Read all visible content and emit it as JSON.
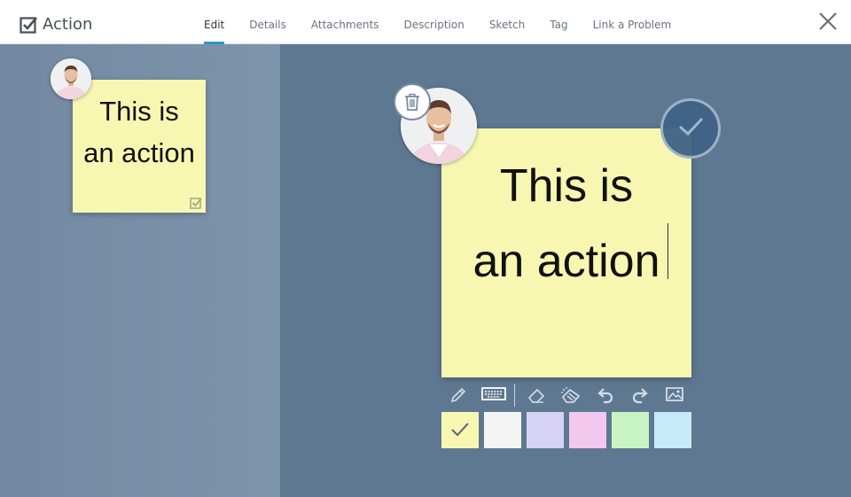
{
  "header": {
    "title": "Action",
    "tabs": [
      {
        "label": "Edit",
        "active": true
      },
      {
        "label": "Details"
      },
      {
        "label": "Attachments"
      },
      {
        "label": "Description"
      },
      {
        "label": "Sketch"
      },
      {
        "label": "Tag"
      },
      {
        "label": "Link a Problem"
      }
    ],
    "icons": {
      "title": "checkbox-icon",
      "close": "close-icon"
    }
  },
  "left_panel": {
    "note": {
      "line1": "This is",
      "line2": "an action",
      "color": "#f8f7b1"
    }
  },
  "editor": {
    "note": {
      "line1": "This is",
      "line2": "an action",
      "color": "#f8f7b1"
    },
    "tools": [
      "pencil-icon",
      "keyboard-icon",
      "eraser-icon",
      "clear-icon",
      "undo-icon",
      "redo-icon",
      "image-icon"
    ],
    "colors": [
      {
        "name": "yellow",
        "hex": "#f8f7b1",
        "selected": true
      },
      {
        "name": "white",
        "hex": "#f4f4f4"
      },
      {
        "name": "lavender",
        "hex": "#d6d2f4"
      },
      {
        "name": "pink",
        "hex": "#f2c8ef"
      },
      {
        "name": "green",
        "hex": "#c8f4c4"
      },
      {
        "name": "blue",
        "hex": "#c8e9f7"
      }
    ]
  },
  "theme": {
    "accent": "#2f93d8",
    "panel": "#5f7892"
  }
}
